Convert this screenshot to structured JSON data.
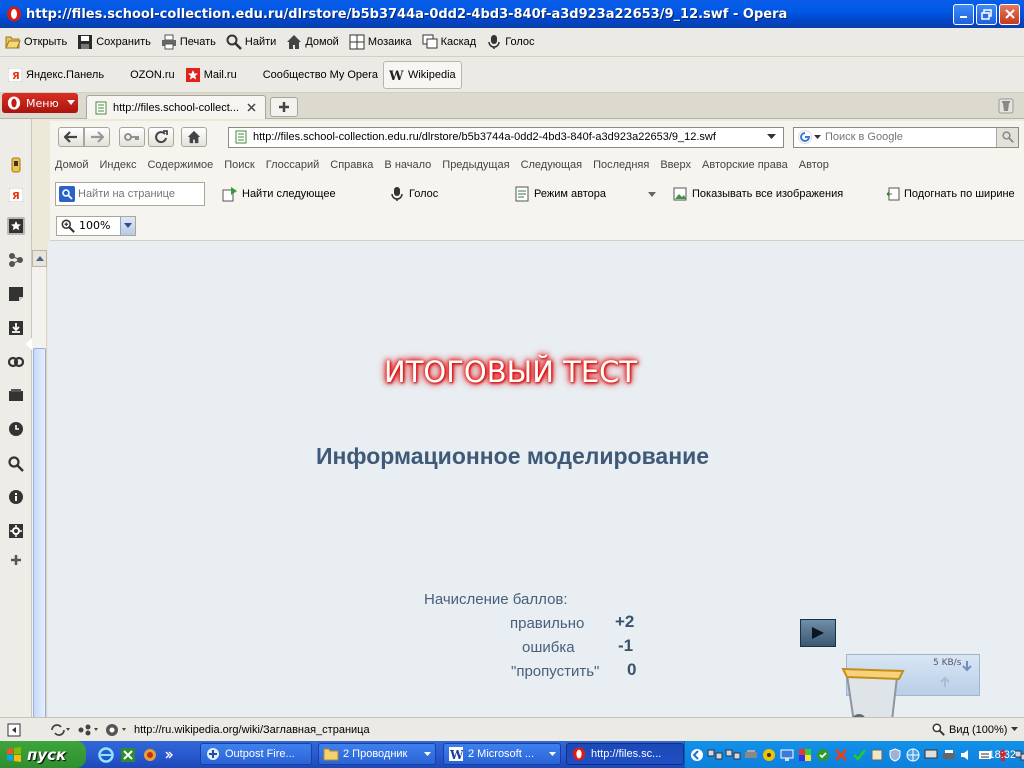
{
  "window": {
    "title": "http://files.school-collection.edu.ru/dlrstore/b5b3744a-0dd2-4bd3-840f-a3d923a22653/9_12.swf - Opera"
  },
  "main_toolbar": [
    "Открыть",
    "Сохранить",
    "Печать",
    "Найти",
    "Домой",
    "Мозаика",
    "Каскад",
    "Голос"
  ],
  "bookmarks": [
    "Яндекс.Панель",
    "OZON.ru",
    "Mail.ru",
    "Сообщество My Opera",
    "Wikipedia"
  ],
  "menu_label": "Меню",
  "tab": {
    "label": "http://files.school-collect..."
  },
  "address": {
    "url": "http://files.school-collection.edu.ru/dlrstore/b5b3744a-0dd2-4bd3-840f-a3d923a22653/9_12.swf"
  },
  "search": {
    "placeholder": "Поиск в Google"
  },
  "nav_links": [
    "Домой",
    "Индекс",
    "Содержимое",
    "Поиск",
    "Глоссарий",
    "Справка",
    "В начало",
    "Предыдущая",
    "Следующая",
    "Последняя",
    "Вверх",
    "Авторские права",
    "Автор"
  ],
  "find_bar": {
    "placeholder": "Найти на странице",
    "find_next": "Найти следующее",
    "voice": "Голос",
    "author_mode": "Режим автора",
    "show_images": "Показывать все изображения",
    "fit_width": "Подогнать по ширине"
  },
  "zoom": {
    "value": "100%"
  },
  "content": {
    "title": "ИТОГОВЫЙ ТЕСТ",
    "subtitle": "Информационное моделирование",
    "scoring_heading": "Начисление баллов:",
    "scoring": [
      {
        "label": "правильно",
        "value": "+2"
      },
      {
        "label": "ошибка",
        "value": "-1"
      },
      {
        "label": "\"пропустить\"",
        "value": "0"
      }
    ]
  },
  "net_monitor": {
    "rate": "5 KB/s"
  },
  "status_bar": {
    "url": "http://ru.wikipedia.org/wiki/Заглавная_страница",
    "zoom": "Вид (100%)"
  },
  "taskbar": {
    "start": "пуск",
    "tasks": [
      "Outpost Fire...",
      "2 Проводник",
      "2 Microsoft ...",
      "http://files.sc..."
    ],
    "clock": "18:32"
  },
  "colors": {
    "title_bar": "#0058e6",
    "opera_red": "#cc1f14",
    "content_bg": "#e9eef2",
    "subtitle": "#3f5a78",
    "taskbar": "#245edb",
    "start": "#3c9a3c"
  }
}
